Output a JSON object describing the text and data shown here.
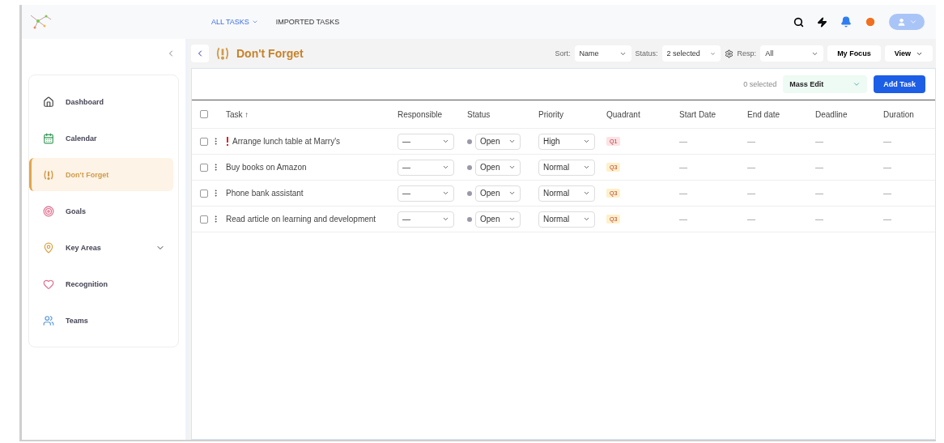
{
  "top_nav": {
    "tabs": [
      {
        "label": "ALL TASKS",
        "selected": true,
        "dropdown": true
      },
      {
        "label": "IMPORTED TASKS",
        "selected": false,
        "dropdown": false
      }
    ]
  },
  "sidebar": {
    "items": [
      {
        "label": "Dashboard",
        "selected": false,
        "expandable": false
      },
      {
        "label": "Calendar",
        "selected": false,
        "expandable": false
      },
      {
        "label": "Don't Forget",
        "selected": true,
        "expandable": false
      },
      {
        "label": "Goals",
        "selected": false,
        "expandable": false
      },
      {
        "label": "Key Areas",
        "selected": false,
        "expandable": true
      },
      {
        "label": "Recognition",
        "selected": false,
        "expandable": false
      },
      {
        "label": "Teams",
        "selected": false,
        "expandable": false
      }
    ]
  },
  "page_title": "Don't Forget",
  "filters": {
    "sort_label": "Sort:",
    "sort_value": "Name",
    "status_label": "Status:",
    "status_value": "2 selected",
    "resp_label": "Resp:",
    "resp_value": "All",
    "focus_button": "My Focus",
    "view_button": "View"
  },
  "toolbar": {
    "selected_count": "0 selected",
    "mass_edit": "Mass Edit",
    "add_button": "Add Task"
  },
  "table": {
    "all_checked": false,
    "columns": [
      "Task ↑",
      "Responsible",
      "Status",
      "Priority",
      "Quadrant",
      "Start Date",
      "End date",
      "Deadline",
      "Duration"
    ],
    "rows": [
      {
        "checked": false,
        "flagged": true,
        "task": "Arrange lunch table at Marry's",
        "responsible": "—",
        "status": "Open",
        "priority": "High",
        "quadrant": "Q1",
        "color": "#fde2e4",
        "start": "—",
        "end": "—",
        "deadline": "—",
        "duration": "—"
      },
      {
        "checked": false,
        "flagged": false,
        "task": "Buy books on Amazon",
        "responsible": "—",
        "status": "Open",
        "priority": "Normal",
        "quadrant": "Q3",
        "color": "#fdf1c9",
        "start": "—",
        "end": "—",
        "deadline": "—",
        "duration": "—"
      },
      {
        "checked": false,
        "flagged": false,
        "task": "Phone bank assistant",
        "responsible": "—",
        "status": "Open",
        "priority": "Normal",
        "quadrant": "Q3",
        "color": "#fdf1c9",
        "start": "—",
        "end": "—",
        "deadline": "—",
        "duration": "—"
      },
      {
        "checked": false,
        "flagged": false,
        "task": "Read article on learning and development",
        "responsible": "—",
        "status": "Open",
        "priority": "Normal",
        "quadrant": "Q3",
        "color": "#fdf1c9",
        "start": "—",
        "end": "—",
        "deadline": "—",
        "duration": "—"
      }
    ]
  }
}
